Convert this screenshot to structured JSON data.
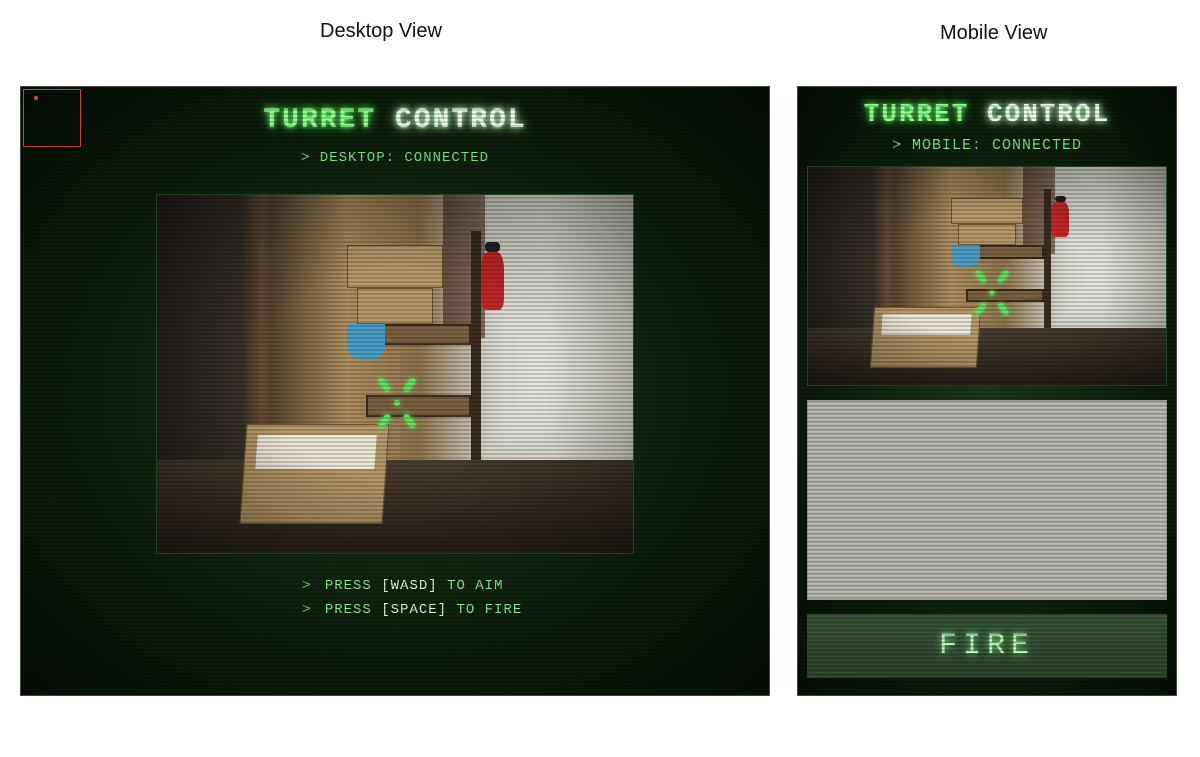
{
  "labels": {
    "desktop_view": "Desktop View",
    "mobile_view": "Mobile View"
  },
  "app": {
    "title_part1": "TURRET",
    "title_part2": "CONTROL"
  },
  "desktop": {
    "status_line": "> DESKTOP: CONNECTED",
    "instructions": {
      "aim_prefix": "PRESS",
      "aim_key": "[WASD]",
      "aim_suffix": "TO AIM",
      "fire_prefix": "PRESS",
      "fire_key": "[SPACE]",
      "fire_suffix": "TO FIRE"
    }
  },
  "mobile": {
    "status_line": "> MOBILE: CONNECTED",
    "fire_button_label": "FIRE"
  },
  "colors": {
    "accent_green": "#8dff8d",
    "bright_text": "#e8ffe8",
    "status_green": "#7fe27f",
    "diag_red": "#d0442a"
  }
}
